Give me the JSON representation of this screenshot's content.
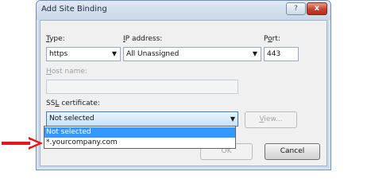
{
  "dialog": {
    "title": "Add Site Binding",
    "help_glyph": "?",
    "close_glyph": "x"
  },
  "type": {
    "label_u": "T",
    "label_rest": "ype:",
    "value": "https"
  },
  "ip": {
    "label_u": "I",
    "label_rest": "P address:",
    "value": "All Unassigned"
  },
  "port": {
    "label_pre": "P",
    "label_u": "o",
    "label_rest": "rt:",
    "value": "443"
  },
  "host": {
    "label_u": "H",
    "label_rest": "ost name:",
    "value": ""
  },
  "ssl": {
    "label_pre": "SS",
    "label_u": "L",
    "label_rest": " certificate:",
    "value": "Not selected",
    "options": [
      "Not selected",
      "*.yourcompany.com"
    ],
    "selected_index": 0
  },
  "buttons": {
    "view_u": "V",
    "view_rest": "iew...",
    "ok": "OK",
    "cancel": "Cancel"
  },
  "icons": {
    "combo_arrow": "▼",
    "help": "help-icon",
    "close": "close-icon",
    "pointer_arrow": "arrow-right-icon"
  },
  "colors": {
    "pointer_arrow": "#e8141b",
    "selection": "#3399ff",
    "close_button": "#c7402d"
  }
}
